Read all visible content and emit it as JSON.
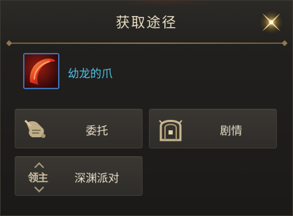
{
  "dialog": {
    "title": "获取途径",
    "close_icon": "close-x-icon"
  },
  "item": {
    "name": "幼龙的爪",
    "icon": "dragon-claw-icon",
    "name_color": "#4dc3e6"
  },
  "sources": [
    {
      "label": "委托",
      "icon": "scroll-quest-icon"
    },
    {
      "label": "剧情",
      "icon": "arch-gate-icon"
    },
    {
      "label": "深渊派对",
      "icon": "boss-tag-icon",
      "icon_text": "领主"
    }
  ]
}
